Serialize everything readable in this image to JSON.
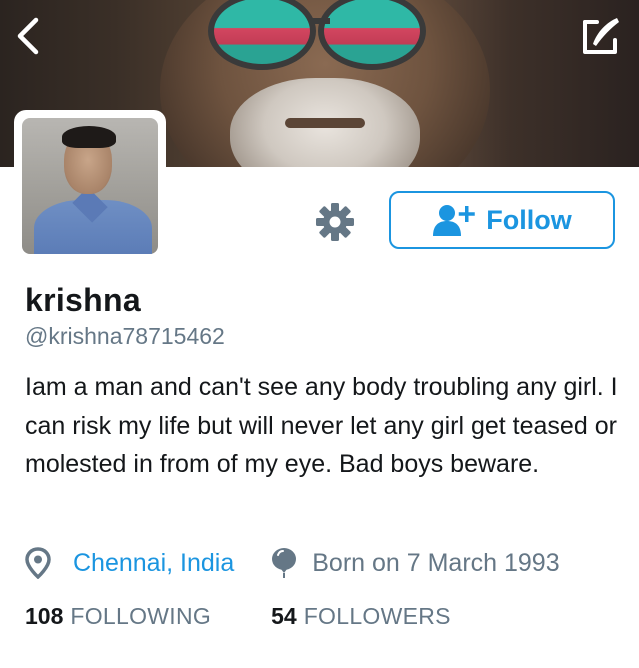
{
  "profile": {
    "name": "krishna",
    "handle": "@krishna78715462",
    "bio": "Iam a man and can't see any body troubling any girl. I can risk my life but will never let any girl get teased or molested in from of my eye. Bad boys beware.",
    "location": "Chennai, India",
    "birthday": "Born on 7 March 1993"
  },
  "actions": {
    "follow_label": "Follow"
  },
  "stats": {
    "following_count": "108",
    "following_label": "FOLLOWING",
    "followers_count": "54",
    "followers_label": "FOLLOWERS"
  },
  "icons": {
    "back": "chevron-left-icon",
    "edit": "compose-icon",
    "settings": "gear-icon",
    "follow": "add-user-icon",
    "location": "location-pin-icon",
    "birthday": "balloon-icon"
  },
  "colors": {
    "accent": "#1b95e0",
    "secondary_text": "#657786",
    "primary_text": "#14171a"
  }
}
